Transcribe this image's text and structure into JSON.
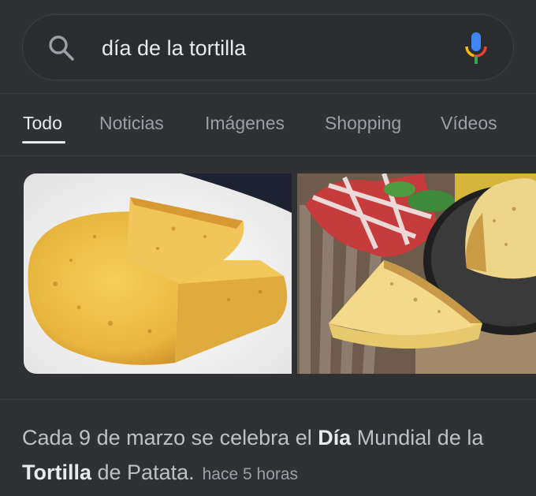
{
  "search": {
    "query": "día de la tortilla",
    "search_icon": "search-icon",
    "mic_icon": "mic-icon"
  },
  "tabs": [
    {
      "label": "Todo",
      "active": true
    },
    {
      "label": "Noticias",
      "active": false
    },
    {
      "label": "Imágenes",
      "active": false
    },
    {
      "label": "Shopping",
      "active": false
    },
    {
      "label": "Vídeos",
      "active": false
    }
  ],
  "snippet": {
    "part1": "Cada 9 de marzo se celebra el ",
    "bold1": "Día",
    "part2": " Mundial de la ",
    "bold2": "Tortilla",
    "part3": " de Patata.",
    "time": "hace 5 horas"
  },
  "colors": {
    "background": "#303134",
    "text": "#e8eaed",
    "muted": "#9aa0a6",
    "mic_blue": "#4285f4",
    "mic_red": "#ea4335",
    "mic_yellow": "#fbbc05",
    "mic_green": "#34a853"
  }
}
